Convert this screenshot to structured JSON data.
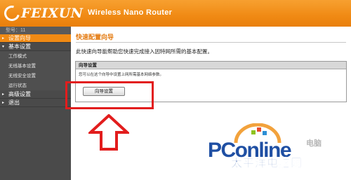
{
  "header": {
    "brand": "FEIXUN",
    "product": "Wireless Nano Router"
  },
  "sidebar": {
    "model_label": "型号：11",
    "items": [
      {
        "label": "设置向导",
        "active": true
      },
      {
        "label": "基本设置",
        "expanded": true
      },
      {
        "label": "高级设置"
      },
      {
        "label": "退出"
      }
    ],
    "subitems": [
      {
        "label": "工作模式"
      },
      {
        "label": "无线基本设置"
      },
      {
        "label": "无线安全设置"
      },
      {
        "label": "运行状态"
      }
    ]
  },
  "main": {
    "title": "快速配置向导",
    "intro": "此快速向导能帮助您快速完成接入因特网所需的基本配置。",
    "panel": {
      "header": "向导设置",
      "description": "您可以在这个向导中设置上网所需基本网络参数。",
      "button_label": "向导设置"
    }
  },
  "watermark": {
    "latin": "PConline",
    "chinese": "太平洋电脑网",
    "sub": "电脑"
  },
  "colors": {
    "header_orange": "#f08a14",
    "sidebar_dark": "#4a4a4a",
    "highlight_red": "#e21d1d",
    "watermark_blue": "#1f4fa3"
  }
}
